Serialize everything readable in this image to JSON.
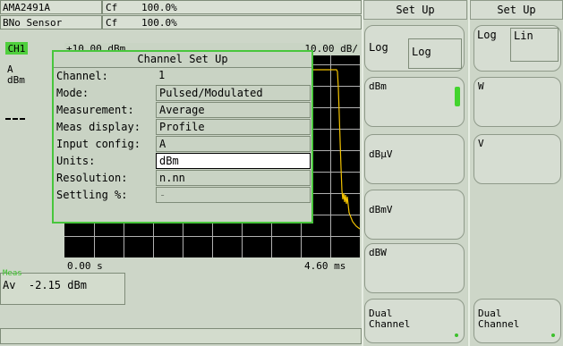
{
  "status": {
    "row1": {
      "sensor": "MA2491A",
      "prefix": "A",
      "cf_label": "Cf",
      "cf_value": "100.0%"
    },
    "row2": {
      "sensor": "No Sensor",
      "prefix": "B",
      "cf_label": "Cf",
      "cf_value": "100.0%"
    }
  },
  "channel_tag": "CH1",
  "left_labels": {
    "input": "A",
    "unit": "dBm"
  },
  "graph": {
    "top_left": "+10.00 dBm",
    "top_right": "10.00 dB/",
    "x_start": "0.00 s",
    "x_end": "4.60 ms"
  },
  "meas": {
    "tag": "Meas",
    "mode": "Av",
    "value": "-2.15 dBm"
  },
  "dialog": {
    "title": "Channel Set Up",
    "rows": [
      {
        "label": "Channel:",
        "value": "1"
      },
      {
        "label": "Mode:",
        "value": "Pulsed/Modulated"
      },
      {
        "label": "Measurement:",
        "value": "Average"
      },
      {
        "label": "Meas display:",
        "value": "Profile"
      },
      {
        "label": "Input config:",
        "value": "A"
      },
      {
        "label": "Units:",
        "value": "dBm"
      },
      {
        "label": "Resolution:",
        "value": "n.nn"
      },
      {
        "label": "Settling %:",
        "value": "-"
      }
    ]
  },
  "softkeys_mid": {
    "title": "Set Up",
    "tab_a": "Log",
    "tab_b": "Log",
    "buttons": [
      "dBm",
      "dBµV",
      "dBmV",
      "dBW",
      "Dual\nChannel"
    ]
  },
  "softkeys_right": {
    "title": "Set Up",
    "tab_a": "Log",
    "tab_b": "Lin",
    "buttons": [
      "W",
      "V",
      "Dual\nChannel"
    ]
  },
  "colors": {
    "accent": "#48c63c",
    "trace": "#f2c200",
    "screen": "#000000"
  }
}
